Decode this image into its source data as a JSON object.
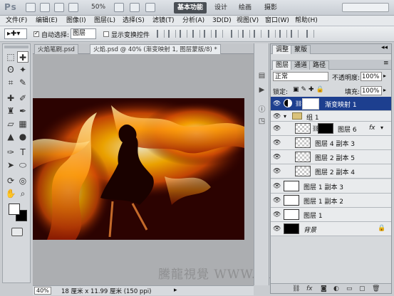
{
  "app": {
    "logo": "Ps",
    "zoom": "50%",
    "workspaces": [
      "基本功能",
      "设计",
      "绘画",
      "摄影"
    ]
  },
  "menu": [
    "文件(F)",
    "编辑(E)",
    "图像(I)",
    "图层(L)",
    "选择(S)",
    "滤镜(T)",
    "分析(A)",
    "3D(D)",
    "视图(V)",
    "窗口(W)",
    "帮助(H)"
  ],
  "options": {
    "auto_select_label": "自动选择:",
    "auto_select_value": "图层",
    "show_transform_label": "显示变换控件"
  },
  "tabs": [
    {
      "label": "火焰笔刷.psd",
      "active": false
    },
    {
      "label": "火焰.psd @ 40% (渐变映射 1, 图层蒙版/8) *",
      "active": true
    }
  ],
  "status": {
    "zoom": "40%",
    "doc_size": "18 厘米 x 11.99 厘米 (150 ppi)"
  },
  "watermark": "騰龍視覺 WWW.TLVI.NET",
  "panel": {
    "top_tabs": [
      "调整",
      "蒙版"
    ],
    "sub_tabs": [
      "图层",
      "通道",
      "路径"
    ],
    "blend_mode": "正常",
    "opacity_label": "不透明度:",
    "opacity": "100%",
    "lock_label": "锁定:",
    "fill_label": "填充:",
    "fill": "100%",
    "layers": [
      {
        "name": "渐变映射 1",
        "selected": true
      },
      {
        "name": "组 1",
        "selected": false
      },
      {
        "name": "图层 6",
        "selected": false
      },
      {
        "name": "图层 4 副本 3",
        "selected": false
      },
      {
        "name": "图层 2 副本 5",
        "selected": false
      },
      {
        "name": "图层 2 副本 4",
        "selected": false
      },
      {
        "name": "图层 1 副本 3",
        "selected": false
      },
      {
        "name": "图层 1 副本 2",
        "selected": false
      },
      {
        "name": "图层 1",
        "selected": false
      },
      {
        "name": "背景",
        "selected": false
      }
    ],
    "fx_label": "fx"
  }
}
